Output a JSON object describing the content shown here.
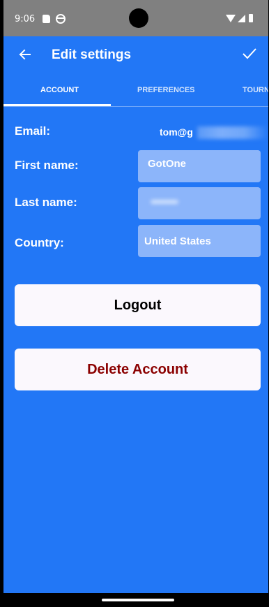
{
  "status_bar": {
    "time": "9:06"
  },
  "app_bar": {
    "title": "Edit settings"
  },
  "tabs": [
    {
      "label": "ACCOUNT",
      "selected": true
    },
    {
      "label": "PREFERENCES",
      "selected": false
    },
    {
      "label": "TOURN",
      "selected": false
    }
  ],
  "form": {
    "email_label": "Email:",
    "email_value": "tom@g",
    "first_name_label": "First name:",
    "first_name_value": "GotOne",
    "last_name_label": "Last name:",
    "last_name_value": "",
    "country_label": "Country:",
    "country_value": "United States"
  },
  "actions": {
    "logout_label": "Logout",
    "delete_label": "Delete Account"
  },
  "colors": {
    "background": "#2277f6",
    "input_fill": "#8cb5fa",
    "button_fill": "#fbf8fd",
    "delete_text": "#8b0000",
    "status_bar": "#808080"
  },
  "icons": {
    "back": "arrow-left-icon",
    "confirm": "checkmark-icon"
  }
}
